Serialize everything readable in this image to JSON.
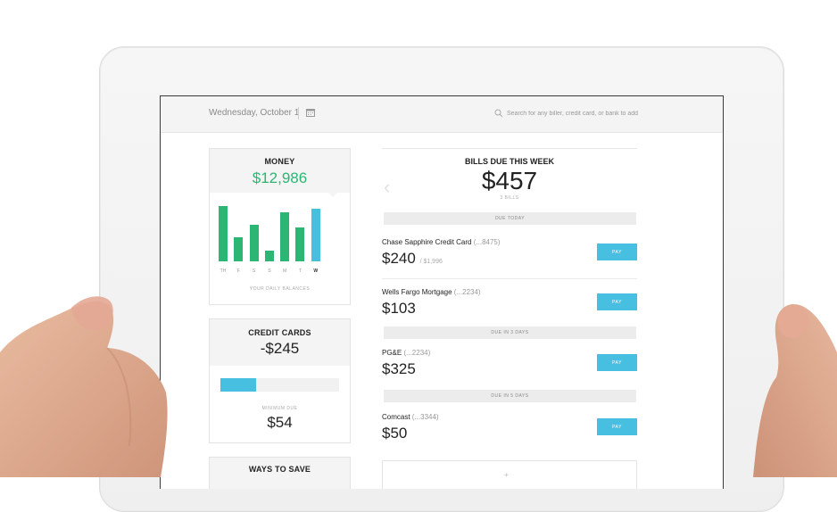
{
  "header": {
    "date": "Wednesday, October 1",
    "search_placeholder": "Search for any biller, credit card, or bank to add",
    "icons": [
      "calendar-icon",
      "search-icon"
    ]
  },
  "money": {
    "title": "MONEY",
    "amount": "$12,986",
    "amount_color": "#2bb673",
    "chart_caption": "YOUR DAILY BALANCES",
    "days": [
      "TH",
      "F",
      "S",
      "S",
      "M",
      "T",
      "W"
    ],
    "active_day": "W",
    "bar_levels": [
      0.97,
      0.42,
      0.64,
      0.19,
      0.86,
      0.59,
      0.92
    ],
    "bar_colors": [
      "#2bb673",
      "#2bb673",
      "#2bb673",
      "#2bb673",
      "#2bb673",
      "#2bb673",
      "#47bfe0"
    ]
  },
  "credit_cards": {
    "title": "CREDIT CARDS",
    "amount": "-$245",
    "utilization": 0.3,
    "min_due_label": "MINIMUM DUE",
    "min_due": "$54"
  },
  "ways_to_save": {
    "title": "WAYS TO SAVE"
  },
  "bills": {
    "title": "BILLS DUE THIS WEEK",
    "total": "$457",
    "count": "3 BILLS",
    "pay_label": "PAY",
    "sections": [
      "DUE TODAY",
      "DUE IN 3 DAYS",
      "DUE IN 5 DAYS"
    ],
    "items": [
      {
        "name": "Chase Sapphire Credit Card",
        "account": "(...8475)",
        "amount": "$240",
        "min": "/ $1,996"
      },
      {
        "name": "Wells Fargo Mortgage",
        "account": "(...2234)",
        "amount": "$103",
        "min": ""
      },
      {
        "name": "PG&E",
        "account": "(...2234)",
        "amount": "$325",
        "min": ""
      },
      {
        "name": "Comcast",
        "account": "(...3344)",
        "amount": "$50",
        "min": ""
      }
    ],
    "add_symbol": "+"
  },
  "accent_color": "#47bfe0"
}
